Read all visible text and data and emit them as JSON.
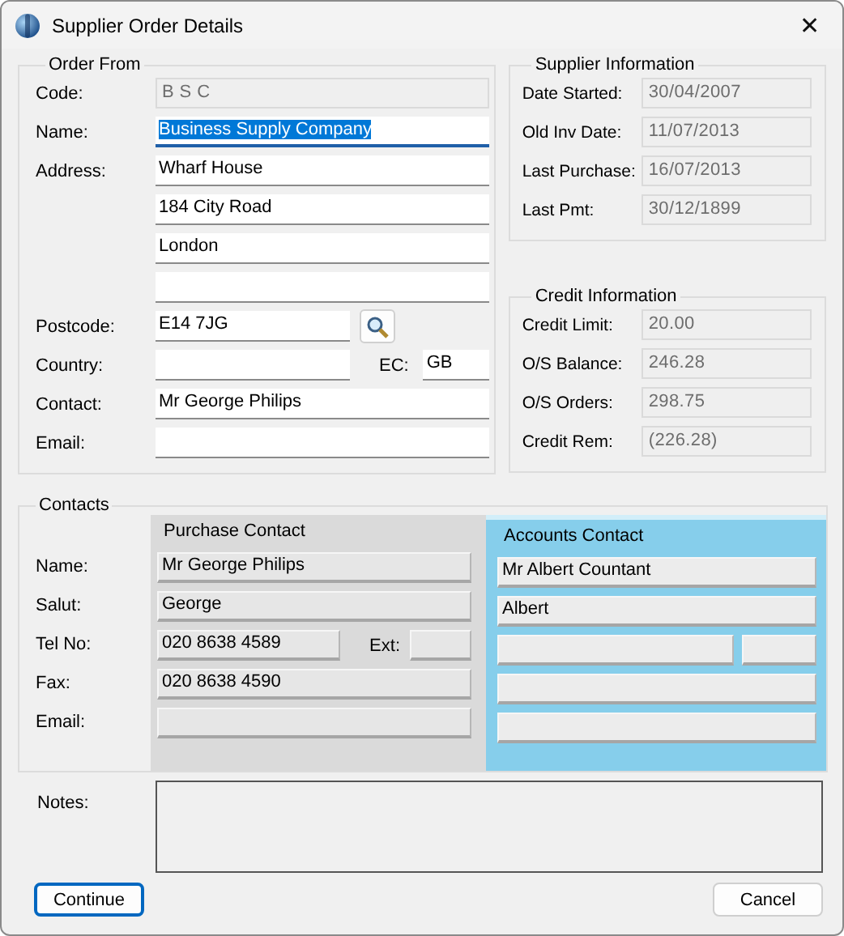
{
  "window": {
    "title": "Supplier Order Details",
    "close": "✕"
  },
  "order_from": {
    "title": "Order From",
    "rows": [
      {
        "label": "Code:",
        "fields": [
          {
            "value": "B S C",
            "readonly": true,
            "selected": false
          }
        ]
      },
      {
        "label": "Name:",
        "fields": [
          {
            "value": "Business Supply Company",
            "readonly": false,
            "selected": true
          }
        ]
      },
      {
        "label": "Address:",
        "fields": [
          {
            "value": "Wharf House",
            "readonly": false,
            "selected": false
          }
        ]
      },
      {
        "fields": [
          {
            "value": "184 City Road",
            "readonly": false,
            "selected": false
          }
        ]
      },
      {
        "fields": [
          {
            "value": "London",
            "readonly": false,
            "selected": false
          }
        ]
      },
      {
        "fields": [
          {
            "readonly": false,
            "selected": false
          }
        ]
      },
      {
        "label": "Postcode:",
        "fields": [
          {
            "value": "E14 7JG",
            "readonly": false,
            "selected": false
          }
        ],
        "search_button": true
      },
      {
        "label": "Country:",
        "fields": [
          {
            "readonly": false,
            "selected": false
          },
          {
            "label": "EC:",
            "value": "GB",
            "readonly": false,
            "selected": false
          }
        ]
      },
      {
        "label": "Contact:",
        "fields": [
          {
            "value": "Mr George Philips",
            "readonly": false,
            "selected": false
          }
        ]
      },
      {
        "label": "Email:",
        "fields": [
          {
            "readonly": false,
            "selected": false
          }
        ]
      }
    ]
  },
  "supplier_info": {
    "title": "Supplier Information",
    "rows": [
      {
        "label": "Date Started:",
        "value": "30/04/2007"
      },
      {
        "label": "Old Inv Date:",
        "value": "11/07/2013"
      },
      {
        "label": "Last Purchase:",
        "value": "16/07/2013"
      },
      {
        "label": "Last Pmt:",
        "value": "30/12/1899"
      }
    ]
  },
  "credit_info": {
    "title": "Credit Information",
    "rows": [
      {
        "label": "Credit Limit:",
        "value": "20.00"
      },
      {
        "label": "O/S Balance:",
        "value": "246.28"
      },
      {
        "label": "O/S Orders:",
        "value": "298.75"
      },
      {
        "label": "Credit Rem:",
        "value": "(226.28)"
      }
    ]
  },
  "contacts": {
    "title": "Contacts",
    "row_labels": [
      "Name:",
      "Salut:",
      "Tel No:",
      "Fax:",
      "Email:"
    ],
    "panels": [
      {
        "title": "Purchase Contact",
        "highlighted": false,
        "rows": [
          {
            "fields": [
              {
                "kind": "wide",
                "value": "Mr George Philips"
              }
            ]
          },
          {
            "fields": [
              {
                "kind": "wide",
                "value": "George"
              }
            ]
          },
          {
            "fields": [
              {
                "kind": "wide",
                "value": "020 8638 4589"
              },
              {
                "kind": "ext",
                "label": "Ext:"
              }
            ]
          },
          {
            "fields": [
              {
                "kind": "wide",
                "value": "020 8638 4590"
              }
            ]
          },
          {
            "fields": [
              {
                "kind": "wide"
              }
            ]
          }
        ]
      },
      {
        "title": "Accounts Contact",
        "highlighted": true,
        "rows": [
          {
            "fields": [
              {
                "kind": "wide",
                "value": "Mr Albert Countant"
              }
            ]
          },
          {
            "fields": [
              {
                "kind": "wide",
                "value": "Albert"
              }
            ]
          },
          {
            "fields": [
              {
                "kind": "wide"
              },
              {
                "kind": "ext"
              }
            ]
          },
          {
            "fields": [
              {
                "kind": "wide"
              }
            ]
          },
          {
            "fields": [
              {
                "kind": "wide"
              }
            ]
          }
        ]
      }
    ]
  },
  "notes": {
    "label": "Notes:"
  },
  "buttons": [
    {
      "label": "Continue",
      "default": true
    },
    {
      "label": "Cancel",
      "default": false
    }
  ]
}
